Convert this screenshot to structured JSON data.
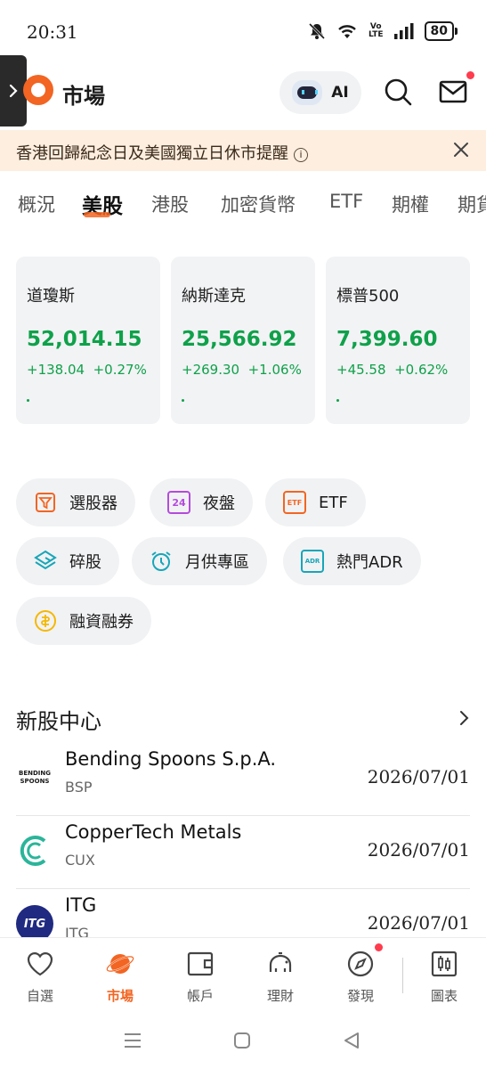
{
  "status_bar": {
    "time": "20:31",
    "volte": "Vo\nLTE",
    "battery": "80"
  },
  "header": {
    "title": "市場",
    "ai_label": "AI"
  },
  "banner": {
    "text": "香港回歸紀念日及美國獨立日休市提醒",
    "info_glyph": "i"
  },
  "tabs": [
    {
      "label": "概況",
      "active": false
    },
    {
      "label": "美股",
      "active": true
    },
    {
      "label": "港股",
      "active": false
    },
    {
      "label": "加密貨幣",
      "active": false
    },
    {
      "label": "ETF",
      "active": false
    },
    {
      "label": "期權",
      "active": false
    },
    {
      "label": "期貨",
      "active": false
    }
  ],
  "indices": [
    {
      "name": "道瓊斯",
      "value": "52,014.15",
      "change": "+138.04",
      "percent": "+0.27%"
    },
    {
      "name": "納斯達克",
      "value": "25,566.92",
      "change": "+269.30",
      "percent": "+1.06%"
    },
    {
      "name": "標普500",
      "value": "7,399.60",
      "change": "+45.58",
      "percent": "+0.62%"
    }
  ],
  "features": [
    {
      "label": "選股器",
      "icon": "filter-icon",
      "color": "#f26522"
    },
    {
      "label": "夜盤",
      "icon": "24h-icon",
      "color": "#b44bdc",
      "icon_text": "24"
    },
    {
      "label": "ETF",
      "icon": "etf-icon",
      "color": "#f26522",
      "icon_text": "ETF"
    },
    {
      "label": "碎股",
      "icon": "fraction-icon",
      "color": "#17a6b8"
    },
    {
      "label": "月供專區",
      "icon": "alarm-clock-icon",
      "color": "#17a6b8"
    },
    {
      "label": "熱門ADR",
      "icon": "adr-icon",
      "color": "#17a6b8",
      "icon_text": "ADR"
    },
    {
      "label": "融資融券",
      "icon": "coin-icon",
      "color": "#f5b800"
    }
  ],
  "ipo_section": {
    "title": "新股中心",
    "items": [
      {
        "name": "Bending Spoons S.p.A.",
        "ticker": "BSP",
        "date": "2026/07/01",
        "logo_text_1": "BENDING",
        "logo_text_2": "SPOONS"
      },
      {
        "name": "CopperTech Metals",
        "ticker": "CUX",
        "date": "2026/07/01"
      },
      {
        "name": "ITG",
        "ticker": "ITG",
        "date": "2026/07/01",
        "logo_text": "ITG"
      }
    ]
  },
  "bottom_nav": [
    {
      "label": "自選",
      "active": false
    },
    {
      "label": "市場",
      "active": true
    },
    {
      "label": "帳戶",
      "active": false
    },
    {
      "label": "理財",
      "active": false
    },
    {
      "label": "發現",
      "active": false
    },
    {
      "label": "圖表",
      "active": false
    }
  ],
  "colors": {
    "accent": "#f26522",
    "up": "#0fa14a",
    "banner_bg": "#fdeee0",
    "notification": "#ff3b4e"
  }
}
